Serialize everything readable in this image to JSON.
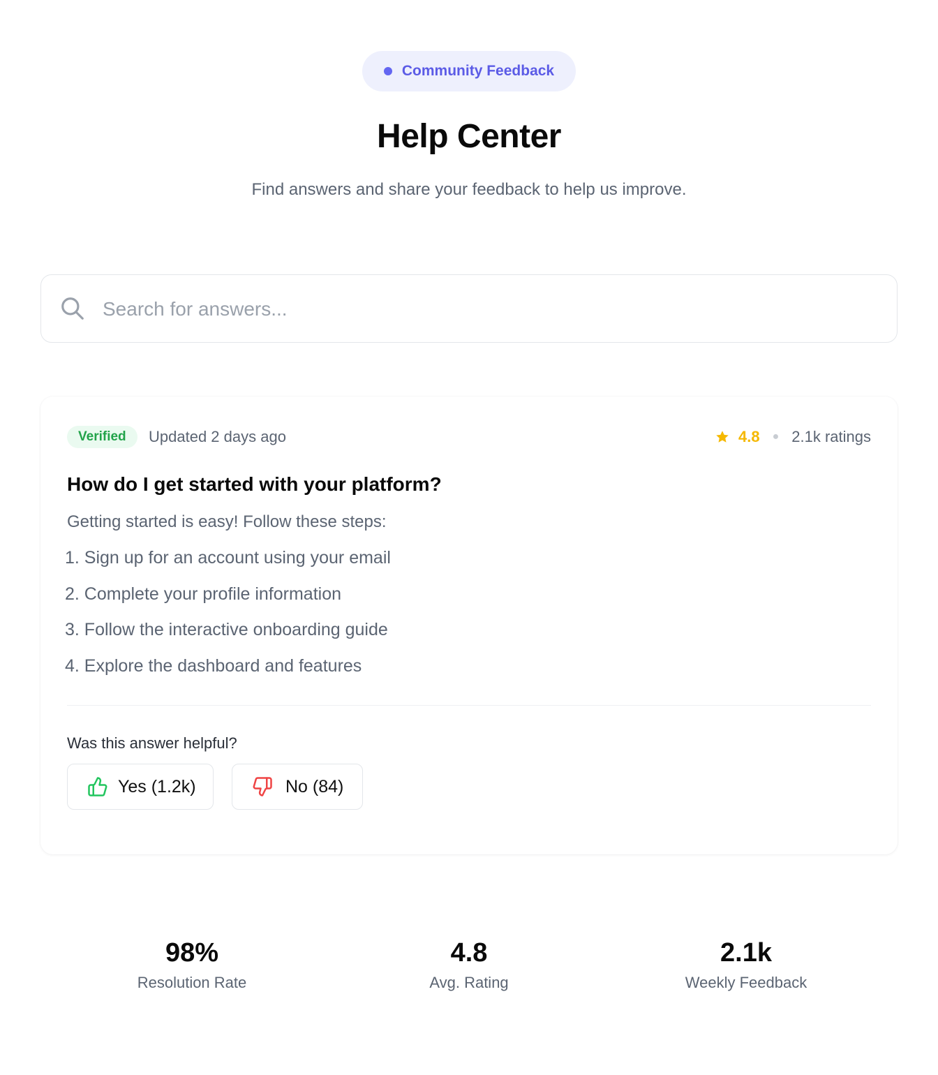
{
  "header": {
    "badge_label": "Community Feedback",
    "title": "Help Center",
    "subtitle": "Find answers and share your feedback to help us improve."
  },
  "search": {
    "placeholder": "Search for answers...",
    "value": "",
    "icon": "search-icon"
  },
  "article": {
    "badge": "Verified",
    "updated": "Updated 2 days ago",
    "rating": "4.8",
    "rating_count": "2.1k ratings",
    "rating_icon": "star-icon",
    "question": "How do I get started with your platform?",
    "intro": "Getting started is easy! Follow these steps:",
    "steps": [
      "1. Sign up for an account using your email",
      "2. Complete your profile information",
      "3. Follow the interactive onboarding guide",
      "4. Explore the dashboard and features"
    ],
    "helpful_prompt": "Was this answer helpful?",
    "yes_label": "Yes (1.2k)",
    "no_label": "No (84)",
    "yes_icon": "thumbs-up-icon",
    "no_icon": "thumbs-down-icon"
  },
  "stats": [
    {
      "value": "98%",
      "label": "Resolution Rate"
    },
    {
      "value": "4.8",
      "label": "Avg. Rating"
    },
    {
      "value": "2.1k",
      "label": "Weekly Feedback"
    }
  ],
  "colors": {
    "accent": "#6366f1",
    "verified": "#22a34a",
    "star": "#f5b800",
    "positive": "#22c55e",
    "negative": "#ef4444"
  }
}
